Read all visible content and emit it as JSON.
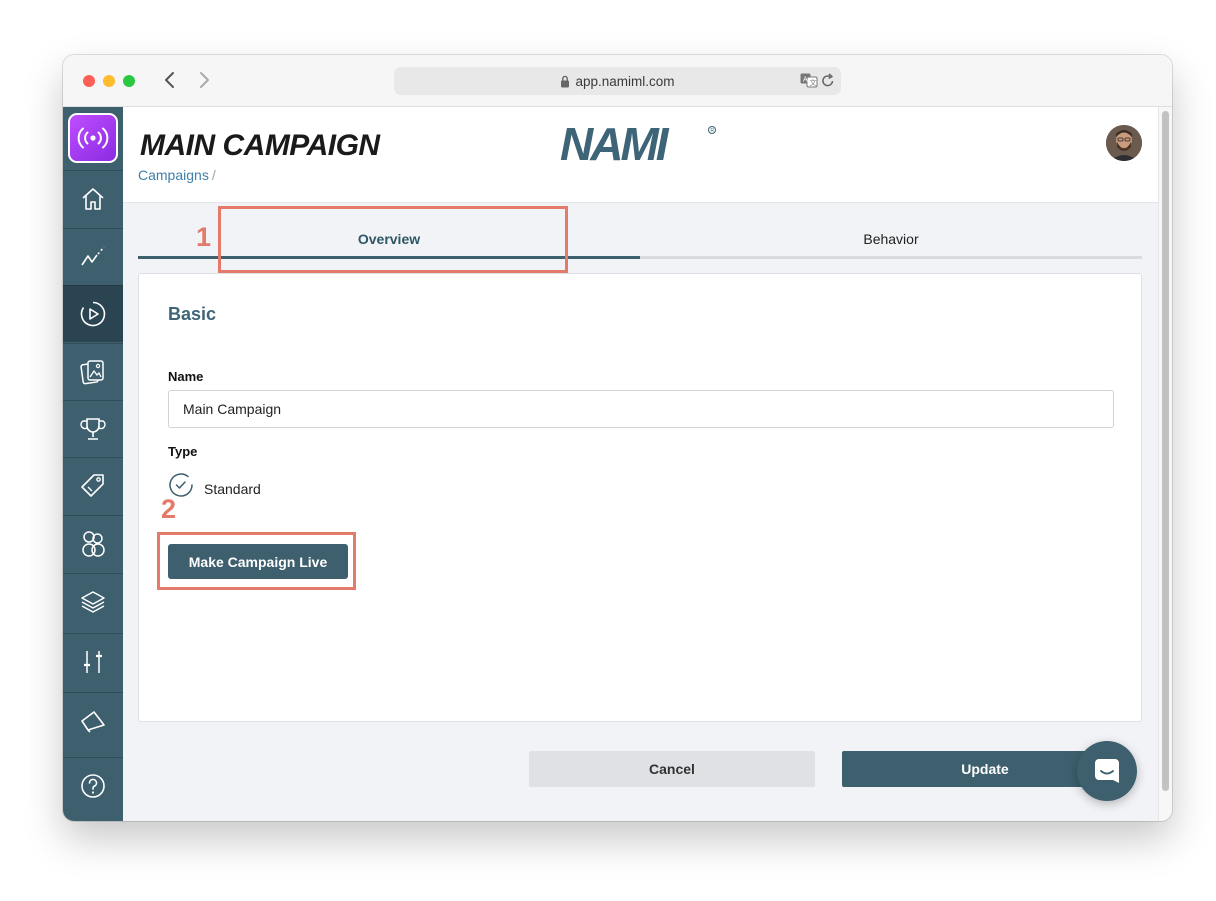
{
  "browser": {
    "url": "app.namiml.com"
  },
  "header": {
    "title": "MAIN CAMPAIGN",
    "breadcrumb": "Campaigns",
    "breadcrumb_sep": "/",
    "brand": "NAMI"
  },
  "sidebar": {
    "items": [
      {
        "icon": "home-icon"
      },
      {
        "icon": "analytics-icon"
      },
      {
        "icon": "campaign-play-icon",
        "active": true
      },
      {
        "icon": "paywalls-icon"
      },
      {
        "icon": "trophy-icon"
      },
      {
        "icon": "tag-icon"
      },
      {
        "icon": "users-icon"
      },
      {
        "icon": "layers-icon"
      },
      {
        "icon": "sliders-icon"
      },
      {
        "icon": "announcement-icon"
      },
      {
        "icon": "help-icon"
      }
    ]
  },
  "tabs": [
    {
      "label": "Overview",
      "active": true
    },
    {
      "label": "Behavior",
      "active": false
    }
  ],
  "form": {
    "section_title": "Basic",
    "name_label": "Name",
    "name_value": "Main Campaign",
    "type_label": "Type",
    "type_option": "Standard",
    "live_button": "Make Campaign Live"
  },
  "footer": {
    "cancel": "Cancel",
    "update": "Update"
  },
  "annotations": {
    "one": "1",
    "two": "2",
    "color": "#e47a6a"
  },
  "colors": {
    "primary": "#3d5f6e",
    "link": "#3d7fa8",
    "accent_gradient": "#c04dff"
  }
}
